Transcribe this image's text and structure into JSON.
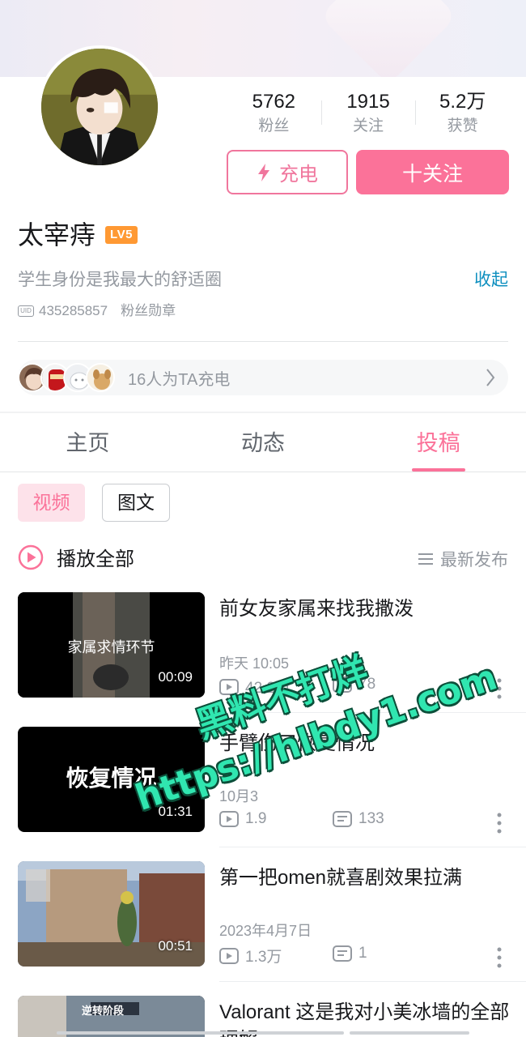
{
  "profile": {
    "name": "太宰痔",
    "level": "LV5",
    "bio": "学生身份是我最大的舒适圈",
    "collapse_label": "收起",
    "uid_icon_text": "UID",
    "uid": "435285857",
    "medal_label": "粉丝勋章"
  },
  "stats": [
    {
      "value": "5762",
      "label": "粉丝"
    },
    {
      "value": "1915",
      "label": "关注"
    },
    {
      "value": "5.2万",
      "label": "获赞"
    }
  ],
  "actions": {
    "charge_label": "充电",
    "follow_label": "十关注"
  },
  "charge_row": {
    "text": "16人为TA充电"
  },
  "tabs": [
    {
      "label": "主页",
      "active": false
    },
    {
      "label": "动态",
      "active": false
    },
    {
      "label": "投稿",
      "active": true
    }
  ],
  "filters": {
    "video": "视频",
    "article": "图文"
  },
  "list_header": {
    "play_all": "播放全部",
    "sort": "最新发布"
  },
  "videos": [
    {
      "title": "前女友家属来找我撒泼",
      "overlay": "家属求情环节",
      "duration": "00:09",
      "date": "昨天 10:05",
      "views": "42.2万",
      "comments": "78"
    },
    {
      "title": "手臂伤口恢复情况",
      "overlay": "恢复情况",
      "duration": "01:31",
      "date": "10月3",
      "views": "1.9",
      "comments": "133"
    },
    {
      "title": "第一把omen就喜剧效果拉满",
      "overlay": "",
      "duration": "00:51",
      "date": "2023年4月7日",
      "views": "1.3万",
      "comments": "1"
    },
    {
      "title": "Valorant 这是我对小美冰墙的全部理解",
      "overlay": "逆转阶段",
      "duration": "",
      "date": "",
      "views": "",
      "comments": ""
    }
  ],
  "watermark": {
    "line1": "黑料不打烊",
    "line2": "https://hlbdy1.com"
  },
  "colors": {
    "accent": "#fb7299",
    "link": "#0d8fbf",
    "level_badge": "#ff9933",
    "watermark": "#30e6b0"
  }
}
